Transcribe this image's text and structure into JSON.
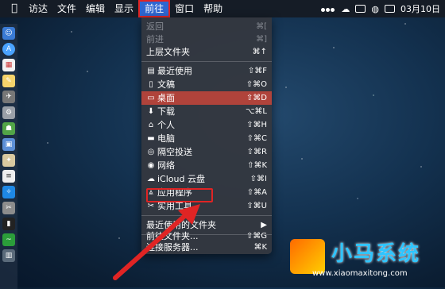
{
  "menubar": {
    "apple_icon": "apple-icon",
    "items": [
      {
        "label": "访达"
      },
      {
        "label": "文件"
      },
      {
        "label": "编辑"
      },
      {
        "label": "显示"
      },
      {
        "label": "前往"
      },
      {
        "label": "窗口"
      },
      {
        "label": "帮助"
      }
    ],
    "date": "03月10日"
  },
  "go_menu": {
    "items": [
      {
        "label": "返回",
        "shortcut": "⌘[",
        "disabled": true
      },
      {
        "label": "前进",
        "shortcut": "⌘]",
        "disabled": true
      },
      {
        "label": "上层文件夹",
        "shortcut": "⌘↑"
      },
      {
        "label": "最近使用",
        "shortcut": "⇧⌘F",
        "icon": "recents-icon"
      },
      {
        "label": "文稿",
        "shortcut": "⇧⌘O",
        "icon": "documents-icon"
      },
      {
        "label": "桌面",
        "shortcut": "⇧⌘D",
        "icon": "desktop-icon",
        "highlighted": true
      },
      {
        "label": "下载",
        "shortcut": "⌥⌘L",
        "icon": "downloads-icon"
      },
      {
        "label": "个人",
        "shortcut": "⇧⌘H",
        "icon": "home-icon"
      },
      {
        "label": "电脑",
        "shortcut": "⇧⌘C",
        "icon": "computer-icon"
      },
      {
        "label": "隔空投送",
        "shortcut": "⇧⌘R",
        "icon": "airdrop-icon"
      },
      {
        "label": "网络",
        "shortcut": "⇧⌘K",
        "icon": "network-icon"
      },
      {
        "label": "iCloud 云盘",
        "shortcut": "⇧⌘I",
        "icon": "icloud-icon"
      },
      {
        "label": "应用程序",
        "shortcut": "⇧⌘A",
        "icon": "applications-icon"
      },
      {
        "label": "实用工具",
        "shortcut": "⇧⌘U",
        "icon": "utilities-icon"
      },
      {
        "label": "最近使用的文件夹",
        "shortcut": "▶"
      },
      {
        "label": "前往文件夹...",
        "shortcut": "⇧⌘G"
      },
      {
        "label": "连接服务器...",
        "shortcut": "⌘K"
      }
    ]
  },
  "watermark": {
    "title": "小马系统",
    "url": "www.xiaomaxitong.com"
  },
  "colors": {
    "highlight": "#b0433b",
    "annotation": "#e02424",
    "menubar_active": "#2f66d0"
  }
}
